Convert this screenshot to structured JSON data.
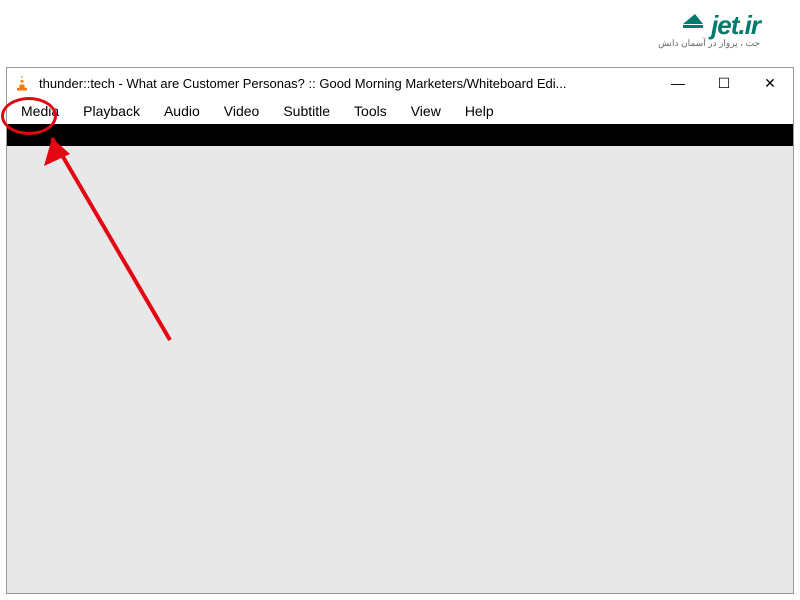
{
  "brand": {
    "name": "jet.ir",
    "tagline": "جت ، پرواز در آسمان دانش"
  },
  "window": {
    "title": "thunder::tech - What are Customer Personas? :: Good Morning Marketers/Whiteboard Edi...",
    "controls": {
      "minimize": "—",
      "maximize": "☐",
      "close": "✕"
    }
  },
  "menu": {
    "items": [
      "Media",
      "Playback",
      "Audio",
      "Video",
      "Subtitle",
      "Tools",
      "View",
      "Help"
    ]
  }
}
